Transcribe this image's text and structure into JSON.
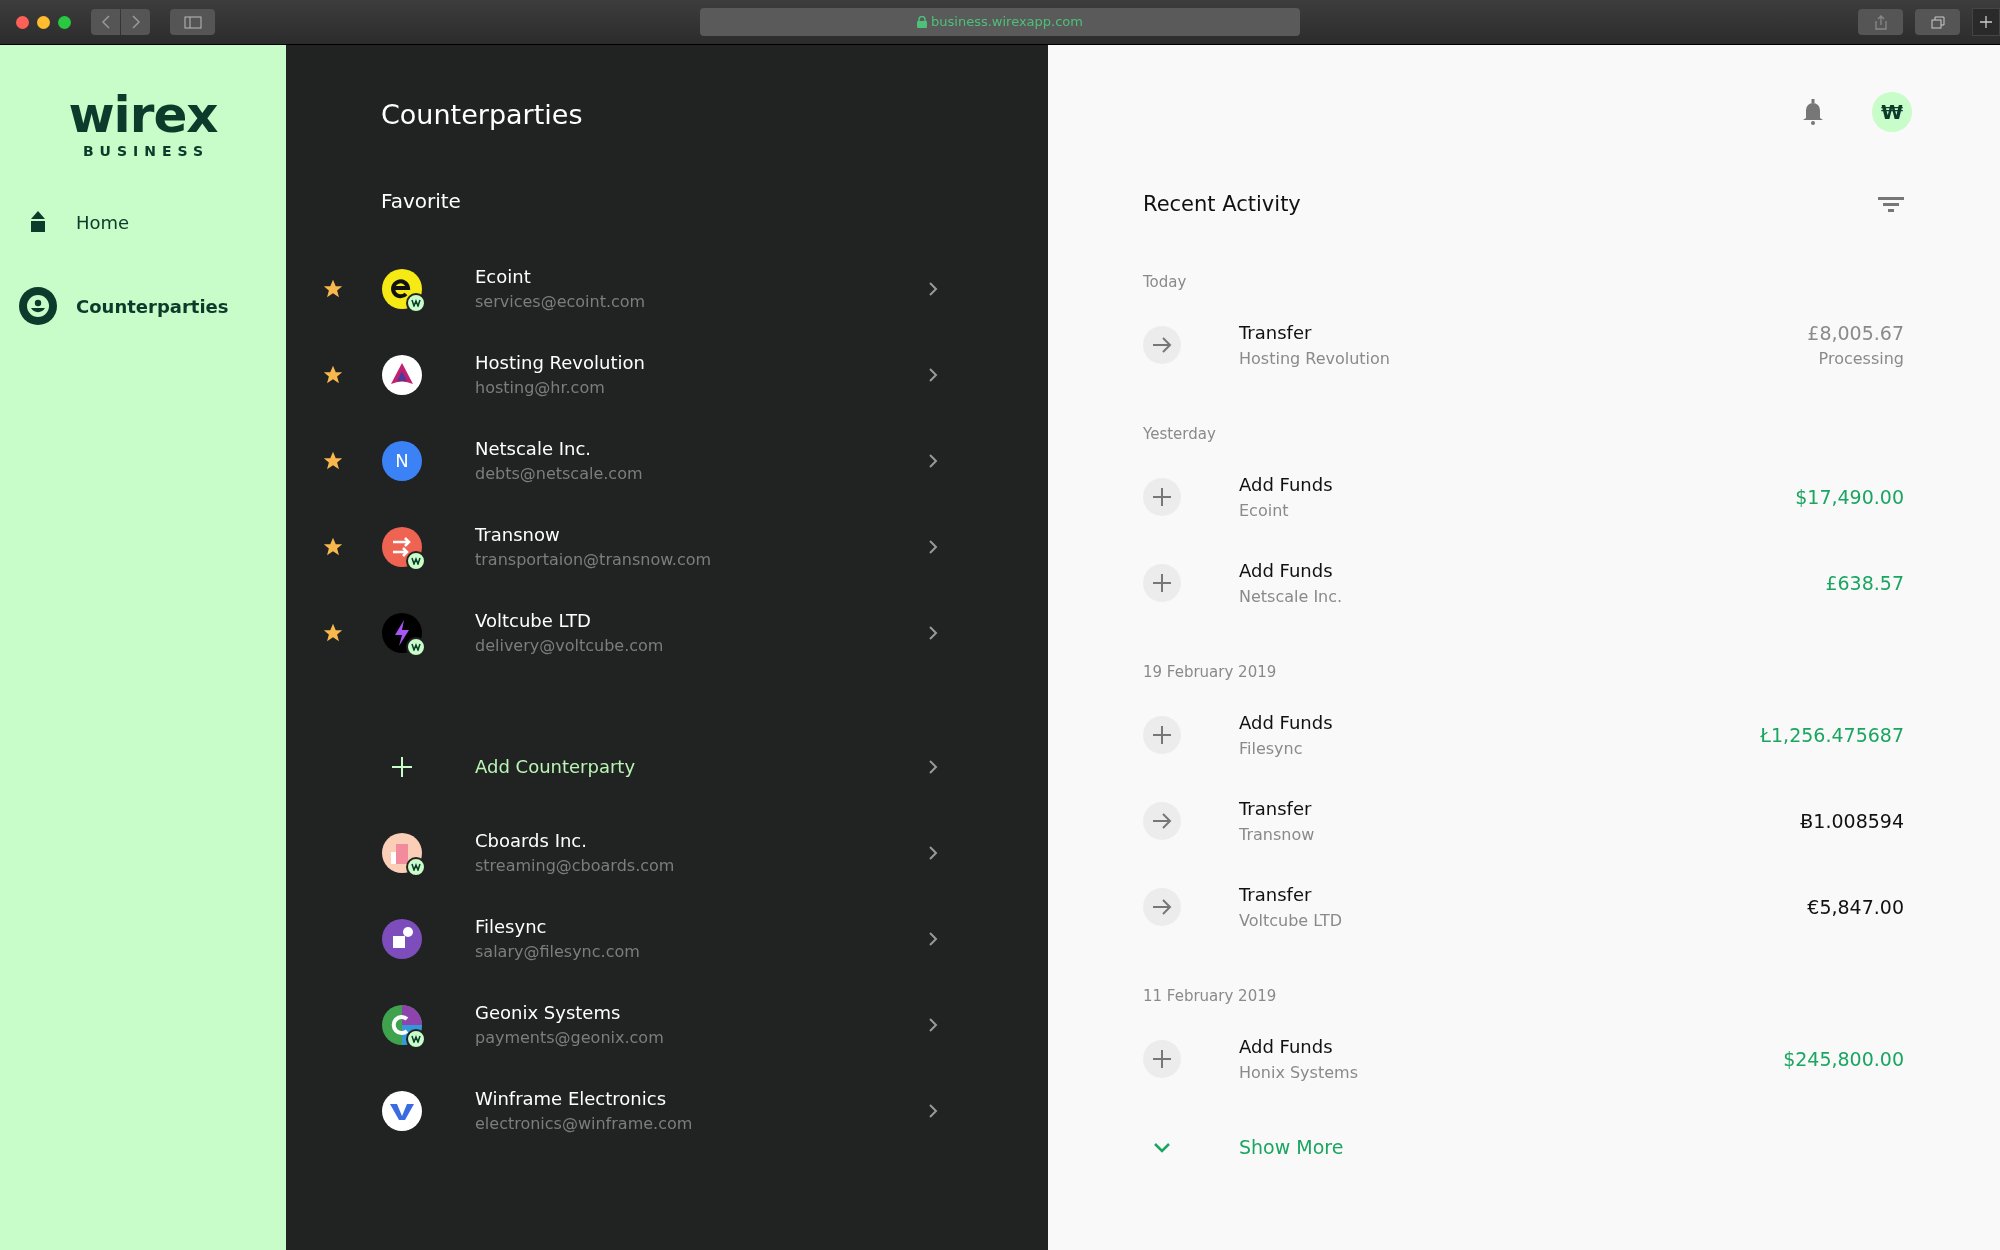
{
  "browser": {
    "url": "business.wirexapp.com"
  },
  "sidebar": {
    "logo": {
      "wordmark": "wirex",
      "subtitle": "BUSINESS"
    },
    "items": [
      {
        "label": "Home",
        "selected": false
      },
      {
        "label": "Counterparties",
        "selected": true
      }
    ]
  },
  "counterparties": {
    "title": "Counterparties",
    "favorite_heading": "Favorite",
    "favorites": [
      {
        "name": "Ecoint",
        "email": "services@ecoint.com",
        "starred": true,
        "kind": "ecoint",
        "color": "#f5ea14",
        "wirex_badge": true
      },
      {
        "name": "Hosting Revolution",
        "email": "hosting@hr.com",
        "starred": true,
        "kind": "triangle",
        "color": "#ffffff",
        "wirex_badge": false
      },
      {
        "name": "Netscale Inc.",
        "email": "debts@netscale.com",
        "starred": true,
        "kind": "letter",
        "letter": "N",
        "color": "#3b82f6",
        "wirex_badge": false
      },
      {
        "name": "Transnow",
        "email": "transportaion@transnow.com",
        "starred": true,
        "kind": "arrows",
        "color": "#ee6352",
        "wirex_badge": true
      },
      {
        "name": "Voltcube LTD",
        "email": "delivery@voltcube.com",
        "starred": true,
        "kind": "bolt",
        "color": "#000000",
        "wirex_badge": true
      }
    ],
    "add_label": "Add Counterparty",
    "others": [
      {
        "name": "Cboards Inc.",
        "email": "streaming@cboards.com",
        "starred": false,
        "kind": "building",
        "color": "#fbcfb7",
        "wirex_badge": true
      },
      {
        "name": "Filesync",
        "email": "salary@filesync.com",
        "starred": false,
        "kind": "shape",
        "color": "#7c4dbb",
        "wirex_badge": false
      },
      {
        "name": "Geonix Systems",
        "email": "payments@geonix.com",
        "starred": false,
        "kind": "mosaic",
        "color": "#3fa34d",
        "wirex_badge": true
      },
      {
        "name": "Winframe Electronics",
        "email": "electronics@winframe.com",
        "starred": false,
        "kind": "w",
        "color": "#ffffff",
        "wirex_badge": false
      }
    ]
  },
  "header": {
    "avatar_text": "₩"
  },
  "activity": {
    "title": "Recent Activity",
    "groups": [
      {
        "label": "Today",
        "items": [
          {
            "kind": "transfer",
            "title": "Transfer",
            "party": "Hosting Revolution",
            "amount": "£8,005.67",
            "status": "Processing"
          }
        ]
      },
      {
        "label": "Yesterday",
        "items": [
          {
            "kind": "add",
            "title": "Add Funds",
            "party": "Ecoint",
            "amount": "$17,490.00"
          },
          {
            "kind": "add",
            "title": "Add Funds",
            "party": "Netscale Inc.",
            "amount": "£638.57"
          }
        ]
      },
      {
        "label": "19 February 2019",
        "items": [
          {
            "kind": "add",
            "title": "Add Funds",
            "party": "Filesync",
            "amount": "Ł1,256.475687"
          },
          {
            "kind": "transfer",
            "title": "Transfer",
            "party": "Transnow",
            "amount": "Ƀ1.008594"
          },
          {
            "kind": "transfer",
            "title": "Transfer",
            "party": "Voltcube LTD",
            "amount": "€5,847.00"
          }
        ]
      },
      {
        "label": "11 February 2019",
        "items": [
          {
            "kind": "add",
            "title": "Add Funds",
            "party": "Honix Systems",
            "amount": "$245,800.00"
          }
        ]
      }
    ],
    "show_more": "Show More"
  }
}
